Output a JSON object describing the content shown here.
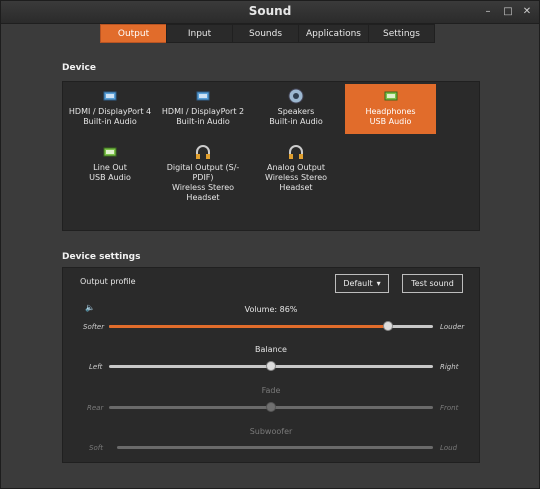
{
  "window": {
    "title": "Sound"
  },
  "tabs": [
    {
      "label": "Output",
      "active": true
    },
    {
      "label": "Input",
      "active": false
    },
    {
      "label": "Sounds",
      "active": false
    },
    {
      "label": "Applications",
      "active": false
    },
    {
      "label": "Settings",
      "active": false
    }
  ],
  "device_section": {
    "title": "Device"
  },
  "devices": [
    {
      "line1": "HDMI / DisplayPort 4",
      "line2": "Built-in Audio",
      "icon": "card-icon",
      "active": false
    },
    {
      "line1": "HDMI / DisplayPort 2",
      "line2": "Built-in Audio",
      "icon": "card-icon",
      "active": false
    },
    {
      "line1": "Speakers",
      "line2": "Built-in Audio",
      "icon": "speaker-icon",
      "active": false
    },
    {
      "line1": "Headphones",
      "line2": "USB Audio",
      "icon": "card-icon",
      "active": true
    },
    {
      "line1": "Line Out",
      "line2": "USB Audio",
      "icon": "card-icon",
      "active": false
    },
    {
      "line1": "Digital Output (S/-",
      "line2": "PDIF)",
      "line3": "Wireless Stereo",
      "line4": "Headset",
      "icon": "headphones-icon",
      "active": false
    },
    {
      "line1": "Analog Output",
      "line2": "Wireless Stereo",
      "line3": "Headset",
      "icon": "headphones-icon",
      "active": false
    }
  ],
  "settings_section": {
    "title": "Device settings"
  },
  "output_profile": {
    "label": "Output profile",
    "value": "Default"
  },
  "test_sound_label": "Test sound",
  "volume": {
    "label": "Volume: 86%",
    "left": "Softer",
    "right": "Louder",
    "value": 0.86
  },
  "balance": {
    "label": "Balance",
    "left": "Left",
    "right": "Right",
    "value": 0.5
  },
  "fade": {
    "label": "Fade",
    "left": "Rear",
    "right": "Front",
    "value": 0.5
  },
  "subwoofer": {
    "label": "Subwoofer",
    "left": "Soft",
    "right": "Loud",
    "value": 0
  },
  "colors": {
    "accent": "#e16c2b",
    "background": "#3b3b3b",
    "panel": "#2a2a2a"
  }
}
